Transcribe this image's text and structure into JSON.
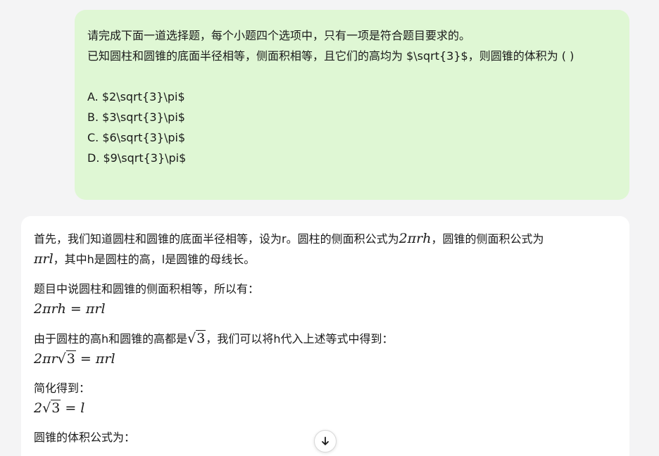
{
  "user_message": {
    "line1": "请完成下面一道选择题，每个小题四个选项中，只有一项是符合题目要求的。",
    "line2": "已知圆柱和圆锥的底面半径相等，侧面积相等，且它们的高均为 $\\sqrt{3}$，则圆锥的体积为 ( )",
    "options": [
      "A. $2\\sqrt{3}\\pi$",
      "B. $3\\sqrt{3}\\pi$",
      "C. $6\\sqrt{3}\\pi$",
      "D. $9\\sqrt{3}\\pi$"
    ]
  },
  "assistant_message": {
    "p1_text_a": "首先，我们知道圆柱和圆锥的底面半径相等，设为r。圆柱的侧面积公式为",
    "p1_math_a": "2πrh",
    "p1_text_b": "，圆锥的侧面积公式为",
    "p1_math_b": "πrl",
    "p1_text_c": "，其中h是圆柱的高，l是圆锥的母线长。",
    "p2_text": "题目中说圆柱和圆锥的侧面积相等，所以有：",
    "p2_math": "2πrh = πrl",
    "p3_text_a": "由于圆柱的高h和圆锥的高都是",
    "p3_sqrt_arg": "3",
    "p3_text_b": "，我们可以将h代入上述等式中得到：",
    "p3_math_pre": "2πr",
    "p3_math_post": " = πrl",
    "p4_text": "简化得到：",
    "p4_math_pre": "2",
    "p4_math_post": " = l",
    "p5_text": "圆锥的体积公式为："
  },
  "scroll_button": {
    "icon": "arrow-down-icon"
  }
}
